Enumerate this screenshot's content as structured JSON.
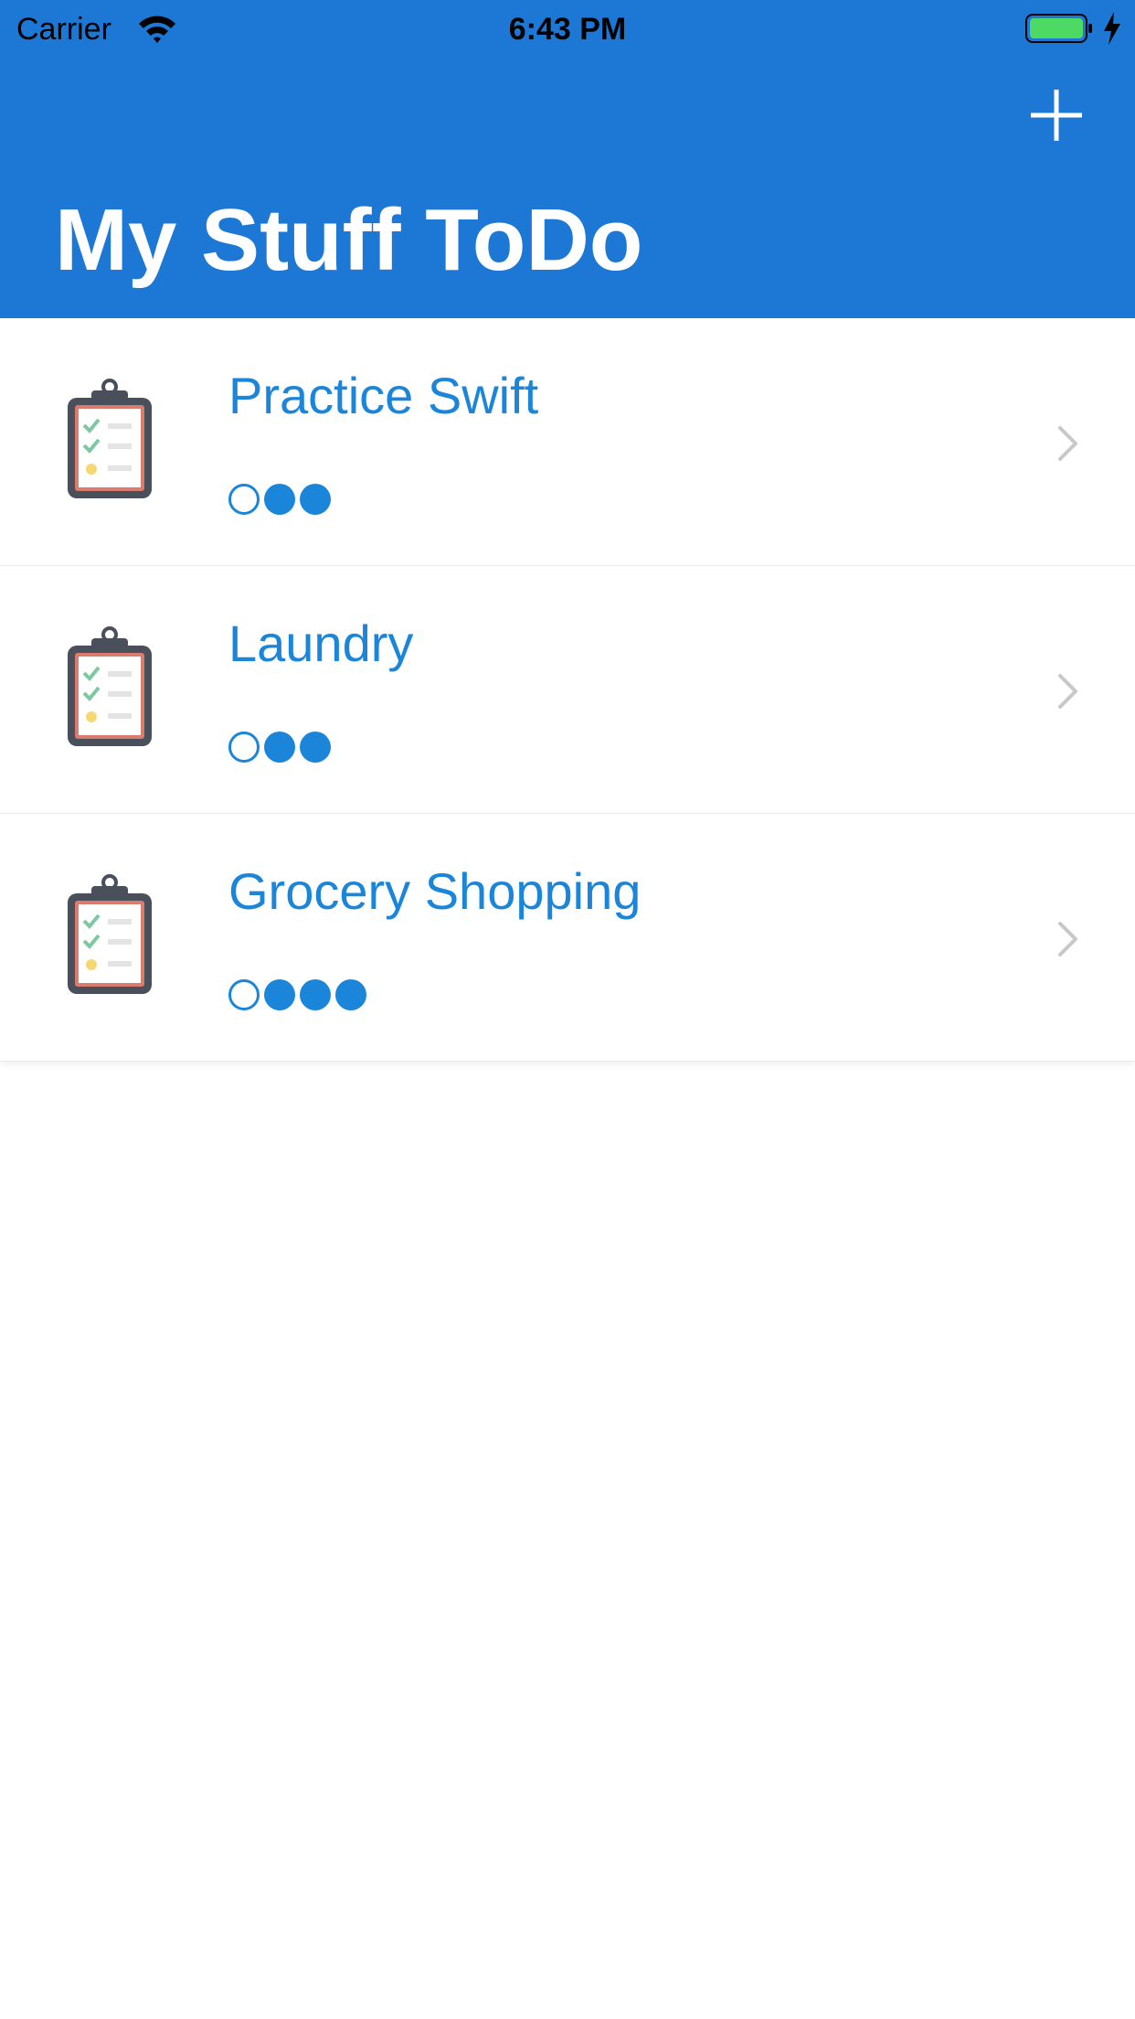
{
  "status_bar": {
    "carrier": "Carrier",
    "time": "6:43 PM",
    "wifi_icon": "wifi-icon",
    "battery_icon": "battery-charging-icon",
    "battery_color": "#4cd964"
  },
  "nav": {
    "title": "My Stuff ToDo",
    "add_icon": "plus-icon",
    "background_color": "#1c78d4"
  },
  "items": [
    {
      "title": "Practice Swift",
      "icon": "clipboard-checklist-icon",
      "priority": {
        "empty": 1,
        "filled": 2
      }
    },
    {
      "title": "Laundry",
      "icon": "clipboard-checklist-icon",
      "priority": {
        "empty": 1,
        "filled": 2
      }
    },
    {
      "title": "Grocery Shopping",
      "icon": "clipboard-checklist-icon",
      "priority": {
        "empty": 1,
        "filled": 3
      }
    }
  ],
  "colors": {
    "accent": "#1b86d9",
    "chevron": "#c7c7cc"
  }
}
